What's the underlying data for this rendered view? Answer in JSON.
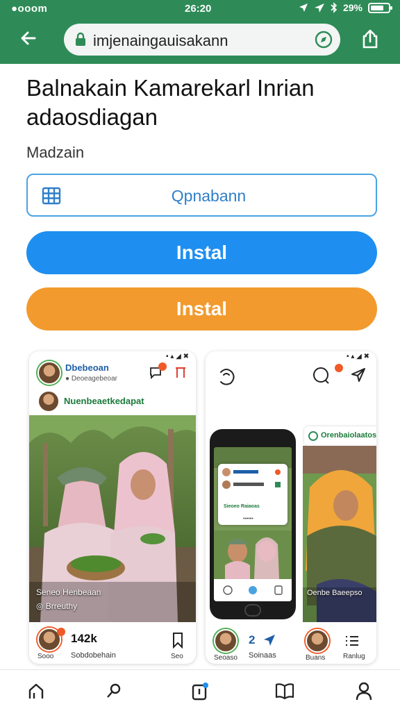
{
  "status_bar": {
    "carrier": "●ooom",
    "time": "26:20",
    "battery": "29%"
  },
  "browser": {
    "url": "imjenaingauisakann"
  },
  "page": {
    "title": "Balnakain Kamarekarl Inrian adaosdiagan",
    "section_label": "Madzain",
    "field_text": "Qpnabann",
    "install_blue": "Instal",
    "install_orange": "Instal"
  },
  "screenshot_left": {
    "status": "▪ ▴ ◢ ✖",
    "profile_name": "Dbebeoan",
    "profile_sub": "● Deoeagebeoar",
    "group_name": "Nuenbeaetkedapat",
    "caption_line1": "Seneo Henbeaan",
    "caption_line2": "◎ Brreuthy",
    "likes": "142k",
    "footer_name1": "Sooo",
    "footer_name2": "Sobdobehain",
    "footer_save": "Seo"
  },
  "screenshot_right": {
    "status": "▪ ▴ ◢ ✖",
    "banner_text": "Orenbaiolaatos",
    "phone_card_title": "Sieoeo Raiaoas",
    "phone_card_sub": "••••••",
    "caption": "Oenbe Baeepso",
    "footer_name1": "Seoaso",
    "footer_count": "2",
    "footer_name2": "Soinaas",
    "footer_name3": "Buans",
    "footer_name4": "Ranlug"
  },
  "colors": {
    "brand_green": "#2e8b57",
    "install_blue": "#1e8ff0",
    "install_orange": "#f29a2e",
    "field_border": "#4aa3e0"
  },
  "icons": [
    "back-arrow-icon",
    "lock-icon",
    "compass-icon",
    "share-icon",
    "grid-icon",
    "chat-icon",
    "gift-icon",
    "bookmark-icon",
    "send-icon",
    "list-icon",
    "home-icon",
    "search-icon",
    "notification-icon",
    "book-icon",
    "profile-icon"
  ]
}
